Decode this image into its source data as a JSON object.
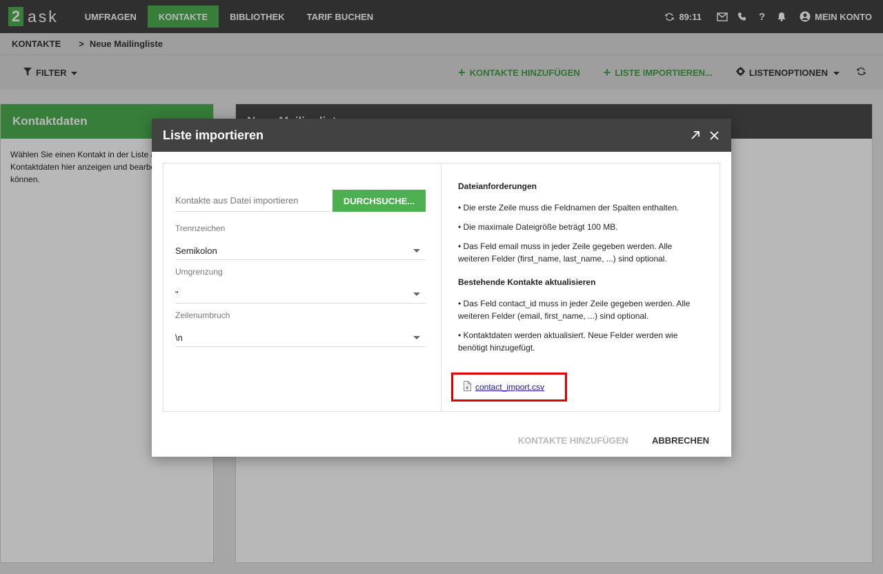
{
  "app": {
    "logo_number": "2",
    "logo_text": "ask"
  },
  "nav": {
    "items": [
      {
        "label": "UMFRAGEN"
      },
      {
        "label": "KONTAKTE"
      },
      {
        "label": "BIBLIOTHEK"
      },
      {
        "label": "TARIF BUCHEN"
      }
    ],
    "timer": "89:11",
    "account_label": "MEIN KONTO"
  },
  "breadcrumb": {
    "root": "KONTAKTE",
    "separator": ">",
    "current": "Neue Mailingliste"
  },
  "toolbar": {
    "filter_label": "FILTER",
    "add_contacts_label": "KONTAKTE HINZUFÜGEN",
    "import_list_label": "LISTE IMPORTIEREN...",
    "list_options_label": "LISTENOPTIONEN"
  },
  "left_panel": {
    "title": "Kontaktdaten",
    "body_text": "Wählen Sie einen Kontakt in der Liste aus, um die Kontaktdaten hier anzeigen und bearbeiten zu können."
  },
  "main_panel": {
    "title": "Neue Mailingliste"
  },
  "modal": {
    "title": "Liste importieren",
    "file_placeholder": "Kontakte aus Datei importieren",
    "browse_label": "DURCHSUCHE...",
    "fields": [
      {
        "label": "Trennzeichen",
        "value": "Semikolon"
      },
      {
        "label": "Umgrenzung",
        "value": "\""
      },
      {
        "label": "Zeilenumbruch",
        "value": "\\n"
      }
    ],
    "requirements_title": "Dateianforderungen",
    "requirements": [
      "• Die erste Zeile muss die Feldnamen der Spalten enthalten.",
      "• Die maximale Dateigröße beträgt 100 MB.",
      "• Das Feld email muss in jeder Zeile gegeben werden. Alle weiteren Felder (first_name, last_name, ...) sind optional."
    ],
    "update_title": "Bestehende Kontakte aktualisieren",
    "update_items": [
      "• Das Feld contact_id muss in jeder Zeile gegeben werden. Alle weiteren Felder (email, first_name, ...) sind optional.",
      "• Kontaktdaten werden aktualisiert. Neue Felder werden wie benötigt hinzugefügt."
    ],
    "sample_file": "contact_import.csv",
    "submit_label": "KONTAKTE HINZUFÜGEN",
    "cancel_label": "ABBRECHEN"
  },
  "colors": {
    "accent_green": "#4caf50",
    "header_dark": "#424242",
    "highlight_red": "#e00000"
  }
}
